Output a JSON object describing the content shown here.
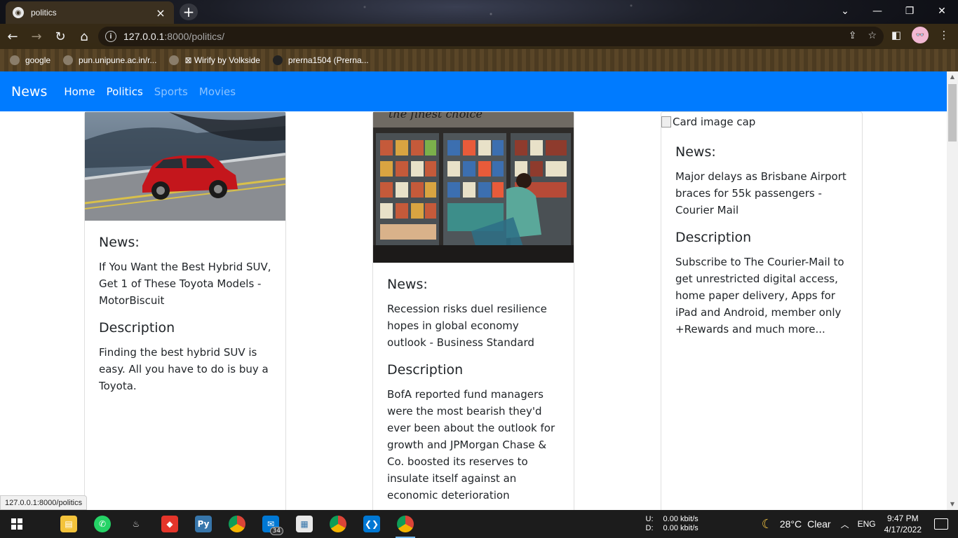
{
  "browser": {
    "tab_title": "politics",
    "tab_favicon": "globe-icon",
    "url_host": "127.0.0.1",
    "url_path": ":8000/politics/",
    "bookmarks": [
      {
        "label": "google"
      },
      {
        "label": "pun.unipune.ac.in/r..."
      },
      {
        "label": "⊠ Wirify by Volkside"
      },
      {
        "label": "prerna1504 (Prerna..."
      }
    ],
    "status_url": "127.0.0.1:8000/politics"
  },
  "navbar": {
    "brand": "News",
    "links": [
      {
        "label": "Home",
        "active": true
      },
      {
        "label": "Politics",
        "active": true
      },
      {
        "label": "Sports",
        "active": false
      },
      {
        "label": "Movies",
        "active": false
      }
    ],
    "color": "#007bff"
  },
  "cards": [
    {
      "image": "red-toyota-suv-photo",
      "news_heading": "News:",
      "news_text": "If You Want the Best Hybrid SUV, Get 1 of These Toyota Models - MotorBiscuit",
      "description_heading": "Description",
      "description_text": "Finding the best hybrid SUV is easy. All you have to do is buy a Toyota."
    },
    {
      "image": "grocery-freezer-aisle-photo",
      "image_caption_partial": "the finest choice",
      "news_heading": "News:",
      "news_text": "Recession risks duel resilience hopes in global economy outlook - Business Standard",
      "description_heading": "Description",
      "description_text": "BofA reported fund managers were the most bearish they'd ever been about the outlook for growth and JPMorgan Chase & Co. boosted its reserves to insulate itself against an economic deterioration"
    },
    {
      "image_alt": "Card image cap",
      "news_heading": "News:",
      "news_text": "Major delays as Brisbane Airport braces for 55k passengers - Courier Mail",
      "description_heading": "Description",
      "description_text": "Subscribe to The Courier-Mail to get unrestricted digital access, home paper delivery, Apps for iPad and Android, member only +Rewards and much more..."
    }
  ],
  "taskbar": {
    "apps": [
      {
        "icon": "file-explorer-icon"
      },
      {
        "icon": "whatsapp-icon"
      },
      {
        "icon": "java-icon"
      },
      {
        "icon": "anydesk-icon"
      },
      {
        "icon": "python-icon"
      },
      {
        "icon": "chrome-icon"
      },
      {
        "icon": "mail-icon",
        "badge": "34"
      },
      {
        "icon": "python-doc-icon"
      },
      {
        "icon": "chrome-profile-icon"
      },
      {
        "icon": "vscode-icon"
      },
      {
        "icon": "chrome-active-icon",
        "active": true
      }
    ],
    "net_up_label": "U:",
    "net_down_label": "D:",
    "net_up_value": "0.00 kbit/s",
    "net_down_value": "0.00 kbit/s",
    "weather_temp": "28°C",
    "weather_text": "Clear",
    "language": "ENG",
    "time": "9:47 PM",
    "date": "4/17/2022"
  }
}
